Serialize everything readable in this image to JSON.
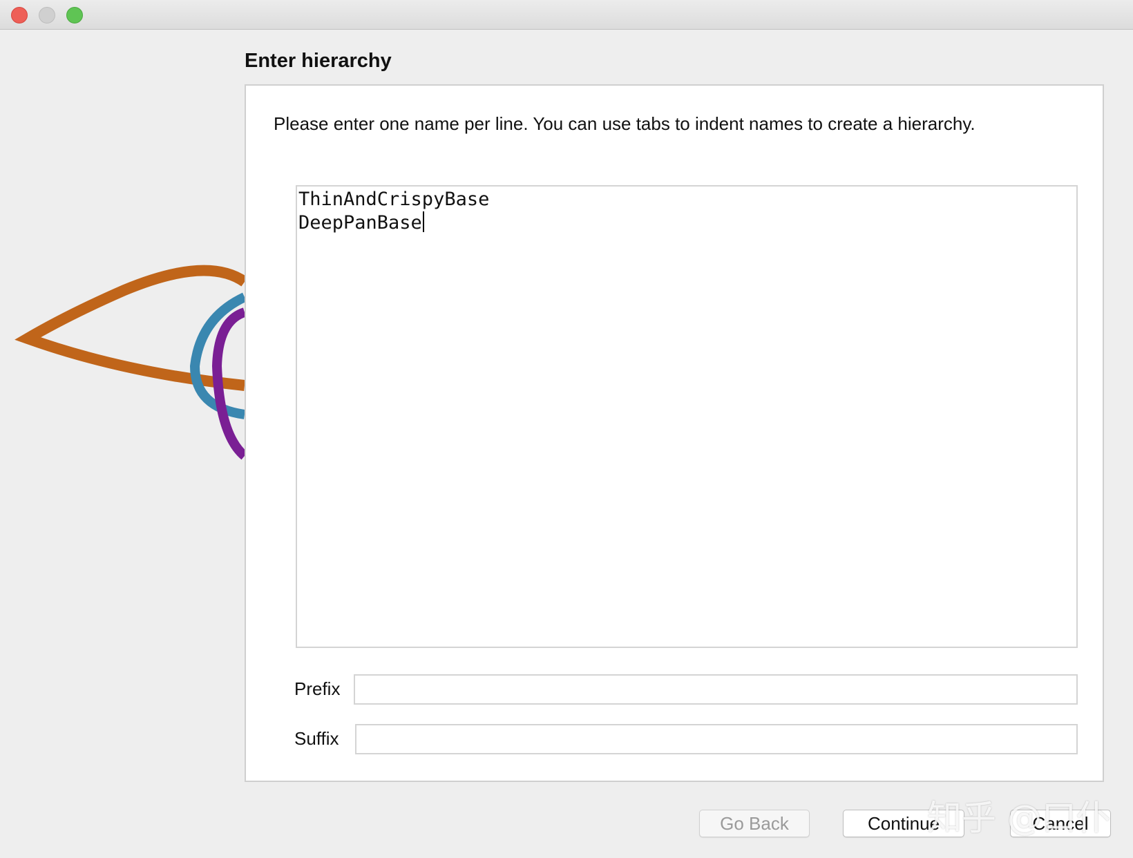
{
  "dialog": {
    "heading": "Enter hierarchy",
    "instructions": "Please enter one name per line. You can use tabs to indent names to create a hierarchy.",
    "names": [
      "ThinAndCrispyBase",
      "DeepPanBase"
    ],
    "prefix": {
      "label": "Prefix",
      "value": ""
    },
    "suffix": {
      "label": "Suffix",
      "value": ""
    }
  },
  "buttons": {
    "go_back": "Go Back",
    "continue": "Continue",
    "cancel": "Cancel"
  },
  "watermark": "知乎 @口仆",
  "colors": {
    "logo_orange": "#c0651a",
    "logo_blue": "#3a87b0",
    "logo_purple": "#7a1f94",
    "close": "#ee5f57",
    "minimize": "#d0d0d0",
    "zoom": "#5fc454"
  },
  "icons": {
    "logo": "protege-eye-logo"
  }
}
